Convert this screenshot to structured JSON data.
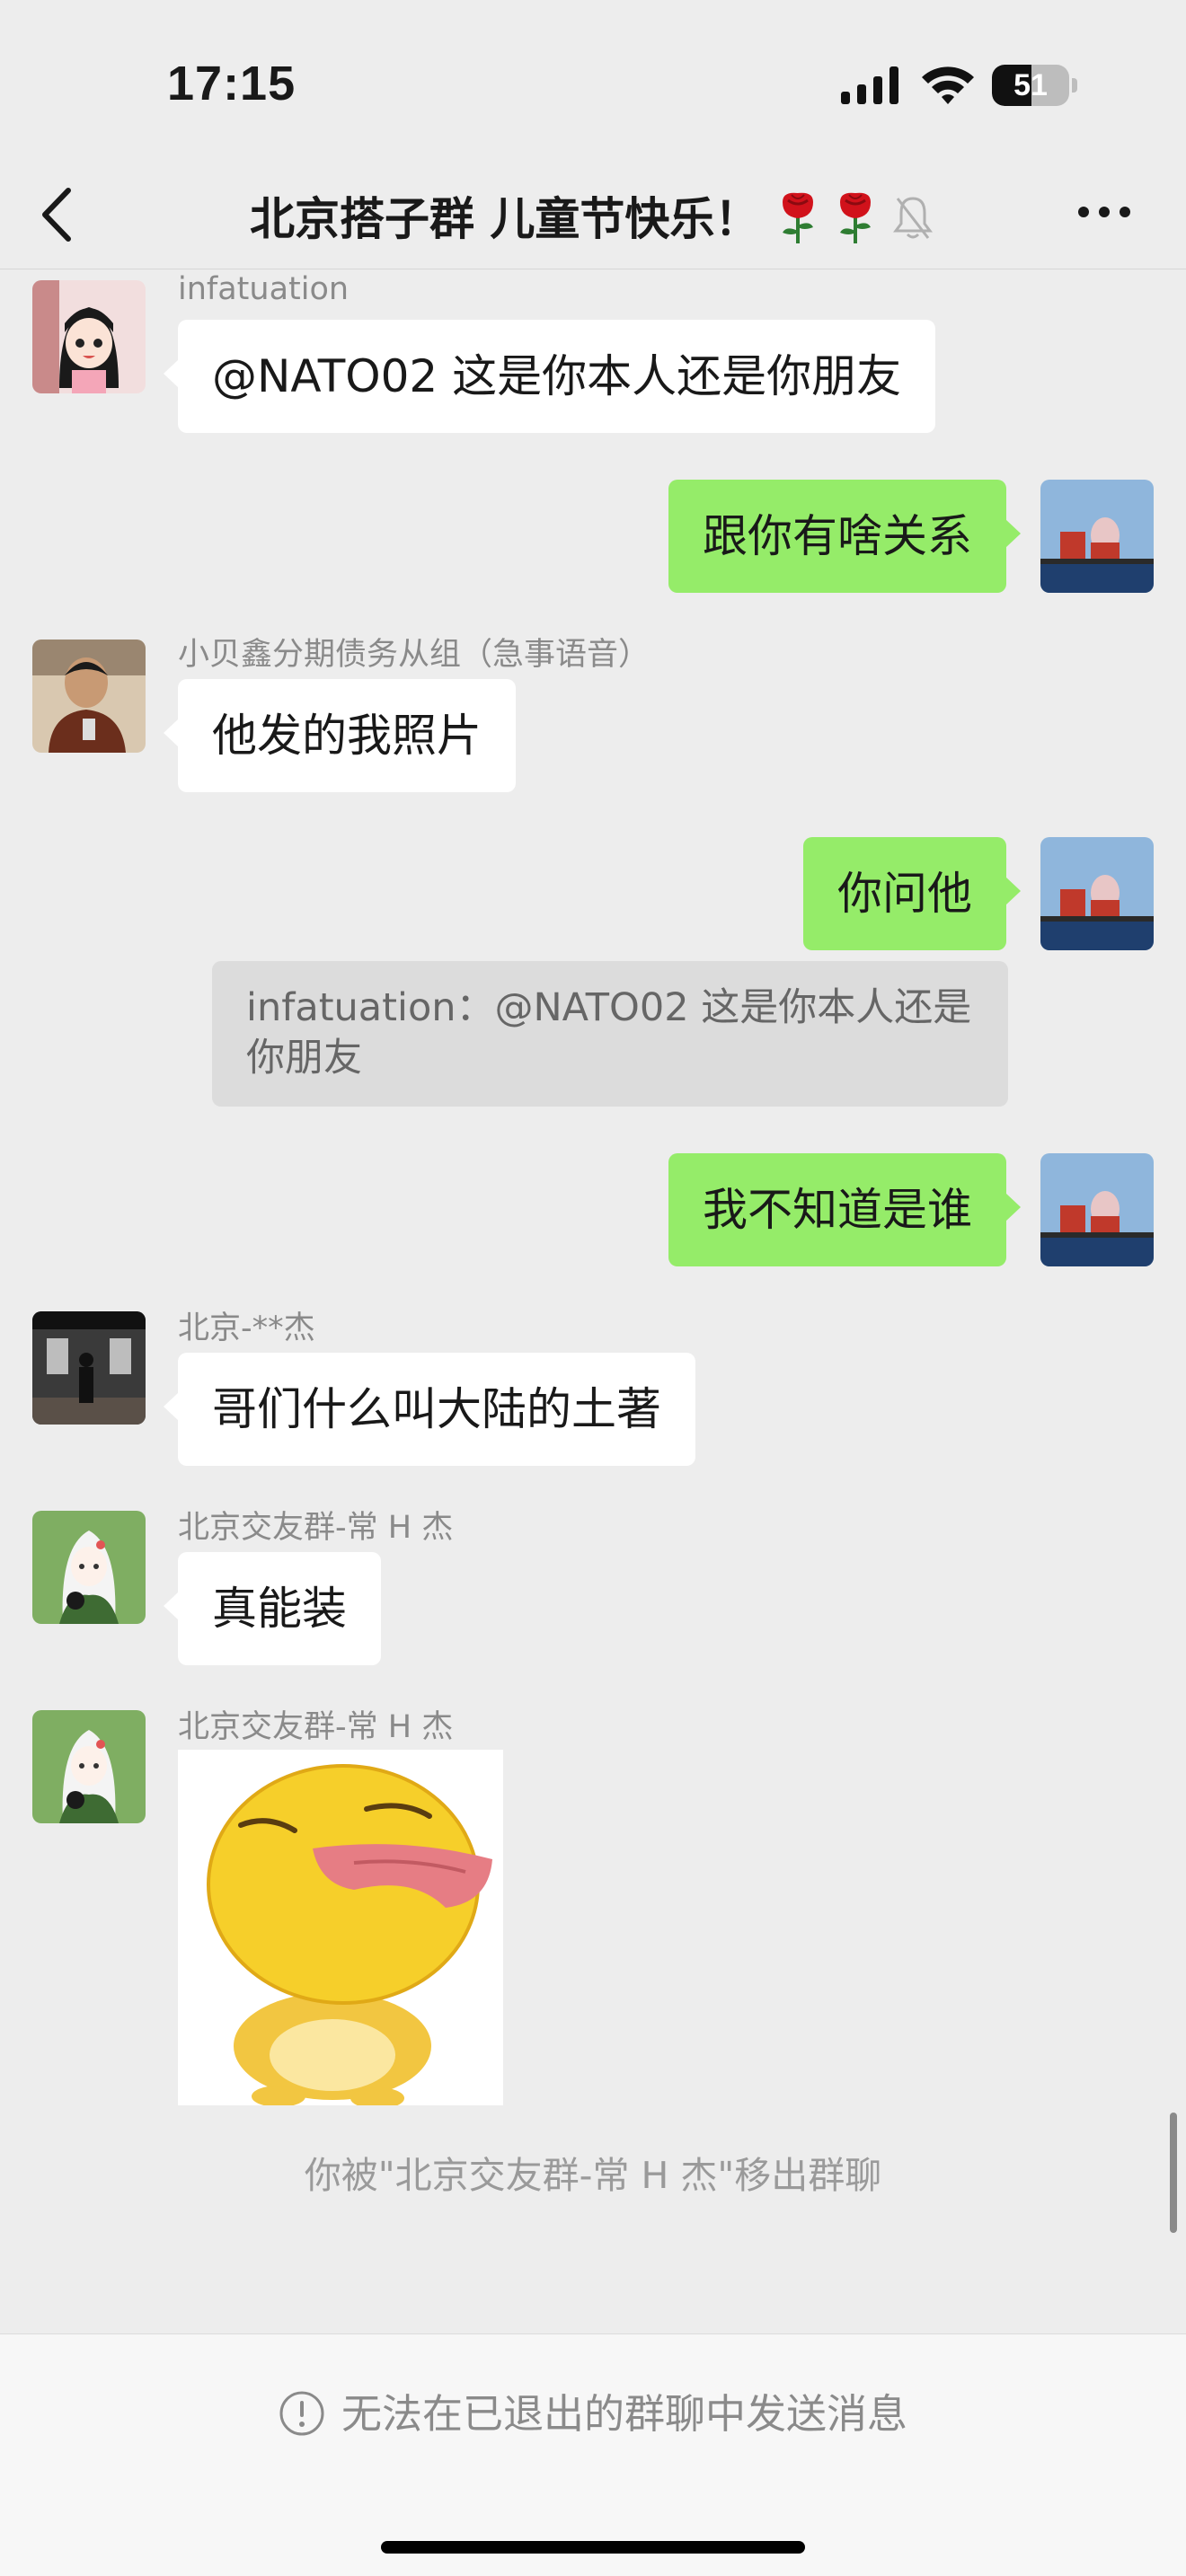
{
  "status_bar": {
    "time": "17:15",
    "battery_level": "51",
    "battery_fraction": 0.51
  },
  "nav": {
    "title": "北京搭子群 儿童节快乐！",
    "emoji_icons": [
      "rose-icon",
      "rose-icon"
    ],
    "muted": true
  },
  "messages": [
    {
      "direction": "in",
      "sender": "infatuation",
      "text": "@NATO02 这是你本人还是你朋友"
    },
    {
      "direction": "out",
      "text": "跟你有啥关系"
    },
    {
      "direction": "in",
      "sender": "小贝鑫分期债务从组（急事语音）",
      "text": "他发的我照片"
    },
    {
      "direction": "out",
      "text": "你问他",
      "quote": "infatuation：@NATO02 这是你本人还是你朋友"
    },
    {
      "direction": "out",
      "text": "我不知道是谁"
    },
    {
      "direction": "in",
      "sender": "北京-**杰",
      "text": "哥们什么叫大陆的土著"
    },
    {
      "direction": "in",
      "sender": "北京交友群-常 H 杰",
      "text": "真能装"
    },
    {
      "direction": "in",
      "sender": "北京交友群-常 H 杰",
      "type": "sticker"
    }
  ],
  "system_message": "你被\"北京交友群-常 H 杰\"移出群聊",
  "footer": {
    "notice": "无法在已退出的群聊中发送消息",
    "icon": "info-icon"
  },
  "colors": {
    "background": "#ededed",
    "outgoing_bubble": "#95ec69",
    "incoming_bubble": "#ffffff"
  }
}
